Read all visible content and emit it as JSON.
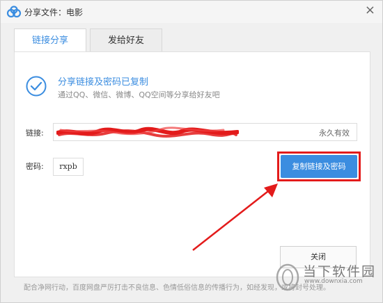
{
  "window": {
    "title": "分享文件：电影",
    "close_glyph": "×"
  },
  "tabs": [
    {
      "label": "链接分享",
      "active": true
    },
    {
      "label": "发给好友",
      "active": false
    }
  ],
  "success": {
    "title": "分享链接及密码已复制",
    "subtitle": "通过QQ、微信、微博、QQ空间等分享给好友吧"
  },
  "link": {
    "label": "链接:",
    "validity": "永久有效"
  },
  "password": {
    "label": "密码:",
    "value": "rxpb"
  },
  "buttons": {
    "copy": "复制链接及密码",
    "close": "关闭"
  },
  "footer": {
    "text": "配合净网行动，百度网盘严厉打击不良信息、色情低俗信息的传播行为，如经发现，或将封号处理。"
  },
  "watermark": {
    "text": "当下软件园",
    "sub": "www.downxia.com"
  },
  "colors": {
    "accent": "#3b8de0",
    "highlight": "#e31b1b"
  }
}
